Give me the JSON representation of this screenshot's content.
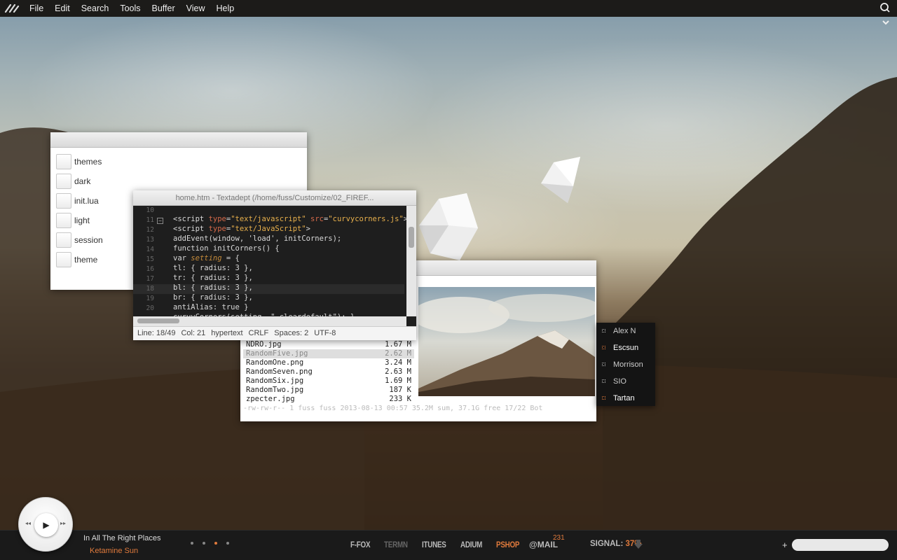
{
  "menubar": {
    "items": [
      "File",
      "Edit",
      "Search",
      "Tools",
      "Buffer",
      "View",
      "Help"
    ]
  },
  "file_window": {
    "items": [
      "themes",
      "dark",
      "init.lua",
      "light",
      "session",
      "theme"
    ]
  },
  "editor": {
    "title": "home.htm - Textadept (/home/fuss/Customize/02_FIREF...",
    "line_numbers": [
      "10",
      "11",
      "12",
      "13",
      "14",
      "15",
      "16",
      "17",
      "18",
      "19",
      "20"
    ],
    "status": {
      "line": "Line: 18/49",
      "col": "Col: 21",
      "lexer": "hypertext",
      "eol": "CRLF",
      "indent": "Spaces: 2",
      "encoding": "UTF-8"
    }
  },
  "file_manager": {
    "files": [
      {
        "name": "NDRO.jpg",
        "size": "1.67 M"
      },
      {
        "name": "RandomFive.jpg",
        "size": "2.62 M",
        "selected": true
      },
      {
        "name": "RandomOne.png",
        "size": "3.24 M"
      },
      {
        "name": "RandomSeven.png",
        "size": "2.63 M"
      },
      {
        "name": "RandomSix.jpg",
        "size": "1.69 M"
      },
      {
        "name": "RandomTwo.jpg",
        "size": "187 K"
      },
      {
        "name": "zpecter.jpg",
        "size": "233 K"
      }
    ],
    "statusbar": "-rw-rw-r-- 1 fuss fuss 2013-08-13 00:57        35.2M sum, 37.1G free  17/22  Bot"
  },
  "contacts": [
    {
      "name": "Alex N",
      "hot": false
    },
    {
      "name": "Escsun",
      "hot": true
    },
    {
      "name": "Morrison",
      "hot": false
    },
    {
      "name": "SIO",
      "hot": false
    },
    {
      "name": "Tartan",
      "hot": true
    }
  ],
  "dock": {
    "song": "In All The Right Places",
    "artist": "Ketamine Sun",
    "apps": [
      {
        "label": "F-FOX",
        "state": "normal"
      },
      {
        "label": "TERMN",
        "state": "dim"
      },
      {
        "label": "ITUNES",
        "state": "normal"
      },
      {
        "label": "ADIUM",
        "state": "normal"
      },
      {
        "label": "PSHOP",
        "state": "active"
      }
    ],
    "mail_label": "@MAIL",
    "mail_count": "231",
    "signal_label": "SIGNAL:",
    "signal_value": "37%",
    "plus": "+"
  },
  "colors": {
    "accent": "#e07a3c",
    "dock": "#1a1a1a",
    "menubar": "#1c1b19"
  },
  "icons": [
    "app-logo-icon",
    "search-icon",
    "chevron-down-icon",
    "play-icon",
    "prev-icon",
    "next-icon",
    "download-arrow-icon",
    "plus-icon"
  ]
}
